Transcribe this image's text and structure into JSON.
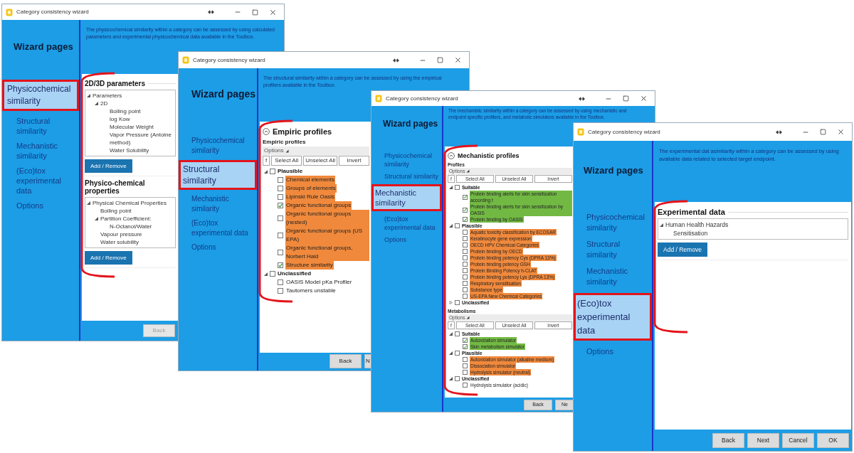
{
  "windows": [
    {
      "title": "Category consistency wizard",
      "sidebar": {
        "heading": "Wizard pages",
        "items": [
          {
            "label": "Physicochemical similarity",
            "selected": true
          },
          {
            "label": "Structural similarity",
            "selected": false
          },
          {
            "label": "Mechanistic similarity",
            "selected": false
          },
          {
            "label": "(Eco)tox experimental data",
            "selected": false
          },
          {
            "label": "Options",
            "selected": false
          }
        ]
      },
      "description": "The physicochemical similarity within a category can be assessed by using calculated parameters and experimental physicochemical data available in the Toolbox.",
      "panel": {
        "sections": [
          {
            "kind": "heading",
            "text": "2D/3D parameters"
          },
          {
            "kind": "tree",
            "items": [
              {
                "label": "Parameters",
                "expanded": true,
                "children": [
                  {
                    "label": "2D",
                    "expanded": true,
                    "children": [
                      {
                        "label": "Boiling point"
                      },
                      {
                        "label": "log Kow"
                      },
                      {
                        "label": "Molecular Weight"
                      },
                      {
                        "label": "Vapor Pressure (Antoine method)"
                      },
                      {
                        "label": "Water Solubility"
                      }
                    ]
                  }
                ]
              }
            ]
          },
          {
            "kind": "button",
            "label": "Add / Remove"
          },
          {
            "kind": "heading",
            "text": "Physico-chemical properties"
          },
          {
            "kind": "tree",
            "items": [
              {
                "label": "Physical Chemical Properties",
                "expanded": true,
                "children": [
                  {
                    "label": "Boiling point"
                  },
                  {
                    "label": "Partition Coefficient:",
                    "expanded": true,
                    "children": [
                      {
                        "label": "N-Octanol/Water"
                      }
                    ]
                  },
                  {
                    "label": "Vapour pressure"
                  },
                  {
                    "label": "Water solubility"
                  }
                ]
              }
            ]
          },
          {
            "kind": "button",
            "label": "Add / Remove"
          }
        ]
      },
      "buttons": [
        {
          "label": "Back",
          "disabled": true
        }
      ]
    },
    {
      "title": "Category consistency wizard",
      "sidebar": {
        "heading": "Wizard pages",
        "items": [
          {
            "label": "Physicochemical similarity",
            "selected": false
          },
          {
            "label": "Structural similarity",
            "selected": true
          },
          {
            "label": "Mechanistic similarity",
            "selected": false
          },
          {
            "label": "(Eco)tox experimental data",
            "selected": false
          },
          {
            "label": "Options",
            "selected": false
          }
        ]
      },
      "description": "The structural similarity within a category can be assessed by using the empirical profilers available in the Toolbox.",
      "panel": {
        "sections": [
          {
            "kind": "heading",
            "text": "Empiric profiles",
            "collapsible": true
          },
          {
            "kind": "label",
            "text": "Empiric profiles"
          },
          {
            "kind": "options",
            "label": "Options",
            "buttons": [
              "f",
              "Select All",
              "Unselect All",
              "Invert"
            ]
          },
          {
            "kind": "checklist",
            "items": [
              {
                "label": "Plausible",
                "checked": false,
                "expanded": true,
                "children": [
                  {
                    "label": "Chemical elements",
                    "checked": false,
                    "color": "#f0893c"
                  },
                  {
                    "label": "Groups of elements",
                    "checked": false,
                    "color": "#f0893c"
                  },
                  {
                    "label": "Lipinski Rule Oasis",
                    "checked": false,
                    "color": "#f0893c"
                  },
                  {
                    "label": "Organic functional groups",
                    "checked": true,
                    "color": "#f0893c"
                  },
                  {
                    "label": "Organic functional groups (nested)",
                    "checked": false,
                    "color": "#f0893c"
                  },
                  {
                    "label": "Organic functional groups (US EPA)",
                    "checked": false,
                    "color": "#f0893c"
                  },
                  {
                    "label": "Organic functional groups, Norbert Haid",
                    "checked": false,
                    "color": "#f0893c"
                  },
                  {
                    "label": "Structure similarity",
                    "checked": true,
                    "color": "#f0893c"
                  }
                ]
              },
              {
                "label": "Unclassified",
                "checked": false,
                "expanded": true,
                "children": [
                  {
                    "label": "OASIS Model pKa Profiler",
                    "checked": false
                  },
                  {
                    "label": "Tautomers unstable",
                    "checked": false
                  }
                ]
              }
            ]
          }
        ]
      },
      "buttons": [
        {
          "label": "Back",
          "disabled": false
        },
        {
          "label": "N",
          "disabled": false
        }
      ]
    },
    {
      "title": "Category consistency wizard",
      "sidebar": {
        "heading": "Wizard pages",
        "items": [
          {
            "label": "Physicochemical similarity",
            "selected": false
          },
          {
            "label": "Structural similarity",
            "selected": false
          },
          {
            "label": "Mechanistic similarity",
            "selected": true
          },
          {
            "label": "(Eco)tox experimental data",
            "selected": false
          },
          {
            "label": "Options",
            "selected": false
          }
        ]
      },
      "description": "The mechanistic similarity within a category can be assessed by using mechanistic and endpoint specific profilers, and metabolic simulators available in the Toolbox.",
      "panel": {
        "sections": [
          {
            "kind": "heading",
            "text": "Mechanistic profiles",
            "collapsible": true
          },
          {
            "kind": "label",
            "text": "Profiles"
          },
          {
            "kind": "options",
            "label": "Options",
            "buttons": [
              "f",
              "Select All",
              "Unselect All",
              "Invert"
            ]
          },
          {
            "kind": "checklist",
            "items": [
              {
                "label": "Suitable",
                "checked": false,
                "expanded": true,
                "children": [
                  {
                    "label": "Protein binding alerts for skin sensitization according t",
                    "checked": true,
                    "color": "#72b944"
                  },
                  {
                    "label": "Protein binding alerts for skin sensitization by OASIS",
                    "checked": true,
                    "color": "#72b944"
                  },
                  {
                    "label": "Protein binding by OASIS",
                    "checked": true,
                    "color": "#72b944"
                  }
                ]
              },
              {
                "label": "Plausible",
                "checked": false,
                "expanded": true,
                "children": [
                  {
                    "label": "Aquatic toxicity classification by ECOSAR",
                    "checked": false,
                    "color": "#f0893c"
                  },
                  {
                    "label": "Keratinocyte gene expression",
                    "checked": false,
                    "color": "#f0893c"
                  },
                  {
                    "label": "OECD HPV Chemical Categories",
                    "checked": false,
                    "color": "#f0893c"
                  },
                  {
                    "label": "Protein binding by OECD",
                    "checked": false,
                    "color": "#f0893c"
                  },
                  {
                    "label": "Protein binding potency Cys (DPRA 13%)",
                    "checked": false,
                    "color": "#f0893c"
                  },
                  {
                    "label": "Protein binding potency GSH",
                    "checked": false,
                    "color": "#f0893c"
                  },
                  {
                    "label": "Protein Binding Potency h-CLAT",
                    "checked": false,
                    "color": "#f0893c"
                  },
                  {
                    "label": "Protein binding potency Lys (DPRA 13%)",
                    "checked": false,
                    "color": "#f0893c"
                  },
                  {
                    "label": "Respiratory sensitisation",
                    "checked": false,
                    "color": "#f0893c"
                  },
                  {
                    "label": "Substance type",
                    "checked": false,
                    "color": "#f0893c"
                  },
                  {
                    "label": "US-EPA New Chemical Categories",
                    "checked": false,
                    "color": "#f0893c"
                  }
                ]
              },
              {
                "label": "Unclassified",
                "checked": false,
                "expanded": false
              }
            ]
          },
          {
            "kind": "label",
            "text": "Metabolisms"
          },
          {
            "kind": "options",
            "label": "Options",
            "buttons": [
              "f",
              "Select All",
              "Unselect All",
              "Invert"
            ]
          },
          {
            "kind": "checklist",
            "items": [
              {
                "label": "Suitable",
                "checked": false,
                "expanded": true,
                "children": [
                  {
                    "label": "Autoxidation simulator",
                    "checked": true,
                    "color": "#72b944"
                  },
                  {
                    "label": "Skin metabolism simulator",
                    "checked": true,
                    "color": "#72b944"
                  }
                ]
              },
              {
                "label": "Plausible",
                "checked": false,
                "expanded": true,
                "children": [
                  {
                    "label": "Autoxidation simulator (alkaline medium)",
                    "checked": false,
                    "color": "#f0893c"
                  },
                  {
                    "label": "Dissociation simulator",
                    "checked": false,
                    "color": "#f0893c"
                  },
                  {
                    "label": "Hydrolysis simulator (neutral)",
                    "checked": false,
                    "color": "#f0893c"
                  }
                ]
              },
              {
                "label": "Unclassified",
                "checked": false,
                "expanded": true,
                "children": [
                  {
                    "label": "Hydrolysis simulator (acidic)",
                    "checked": false
                  }
                ]
              }
            ]
          }
        ]
      },
      "buttons": [
        {
          "label": "Back",
          "disabled": false
        },
        {
          "label": "Ne",
          "disabled": false
        }
      ]
    },
    {
      "title": "Category consistency wizard",
      "sidebar": {
        "heading": "Wizard pages",
        "items": [
          {
            "label": "Physicochemical similarity",
            "selected": false
          },
          {
            "label": "Structural similarity",
            "selected": false
          },
          {
            "label": "Mechanistic similarity",
            "selected": false
          },
          {
            "label": "(Eco)tox experimental data",
            "selected": true
          },
          {
            "label": "Options",
            "selected": false
          }
        ]
      },
      "description": "The experimental dat asimilarity within a category can be assessed by using available data related to selected target endpoint.",
      "panel": {
        "sections": [
          {
            "kind": "heading",
            "text": "Experimental data"
          },
          {
            "kind": "tree",
            "items": [
              {
                "label": "Human Health Hazards",
                "expanded": true,
                "children": [
                  {
                    "label": "Sensitisation"
                  }
                ]
              }
            ]
          },
          {
            "kind": "button",
            "label": "Add / Remove"
          }
        ]
      },
      "buttons": [
        {
          "label": "Back",
          "disabled": false
        },
        {
          "label": "Next",
          "disabled": false
        },
        {
          "label": "Cancel",
          "disabled": false
        },
        {
          "label": "OK",
          "disabled": false
        }
      ]
    }
  ]
}
